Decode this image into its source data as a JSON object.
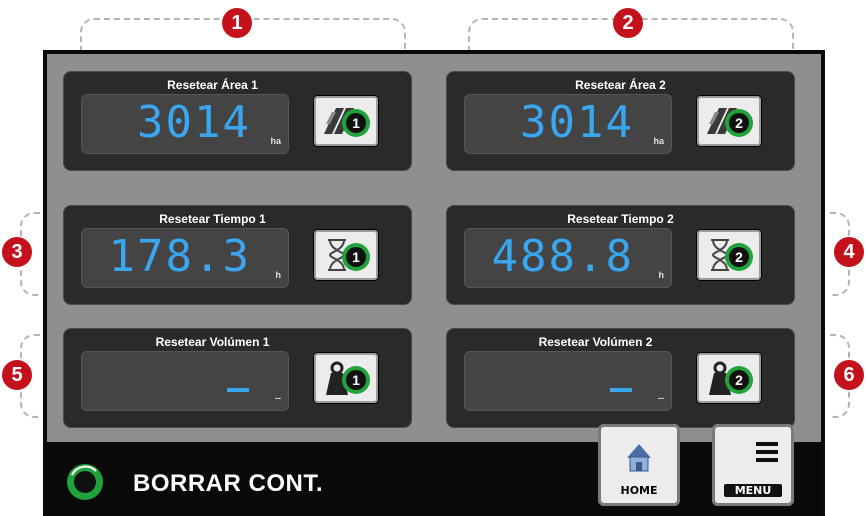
{
  "markers": {
    "m1": "1",
    "m2": "2",
    "m3": "3",
    "m4": "4",
    "m5": "5",
    "m6": "6"
  },
  "panels": {
    "area1": {
      "title": "Resetear Área 1",
      "value": "3014",
      "unit": "ha",
      "badge": "1"
    },
    "area2": {
      "title": "Resetear Área  2",
      "value": "3014",
      "unit": "ha",
      "badge": "2"
    },
    "time1": {
      "title": "Resetear Tiempo 1",
      "value": "178.3",
      "unit": "h",
      "badge": "1"
    },
    "time2": {
      "title": "Resetear Tiempo  2",
      "value": "488.8",
      "unit": "h",
      "badge": "2"
    },
    "vol1": {
      "title": "Resetear Volúmen 1",
      "value": "",
      "unit": "--",
      "badge": "1"
    },
    "vol2": {
      "title": "Resetear Volúmen 2",
      "value": "",
      "unit": "--",
      "badge": "2"
    }
  },
  "bottom": {
    "label": "BORRAR CONT.",
    "home_label": "HOME",
    "menu_label": "MENU"
  },
  "colors": {
    "lcd_digits": "#3aa6f0",
    "marker_red": "#c4111b",
    "reset_green": "#1fa33a"
  }
}
